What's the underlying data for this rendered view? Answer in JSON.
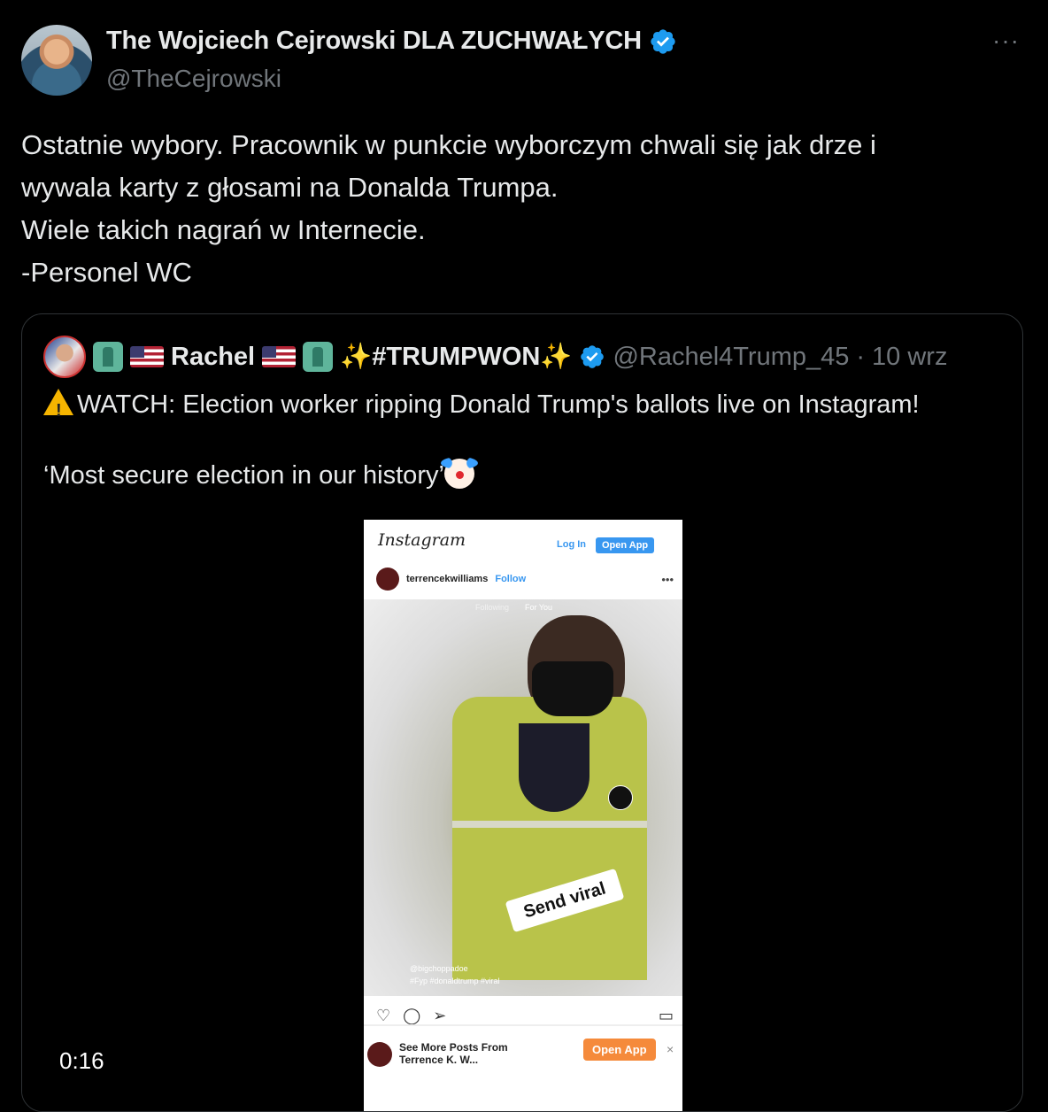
{
  "tweet": {
    "display_name": "The Wojciech Cejrowski DLA ZUCHWAŁYCH",
    "handle": "@TheCejrowski",
    "more_label": "···",
    "text": "Ostatnie wybory. Pracownik w punkcie wyborczym chwali się jak drze i\nwywala karty z głosami na Donalda Trumpa.\nWiele takich nagrań w Internecie.\n-Personel WC"
  },
  "quote": {
    "name": "Rachel",
    "tag": "✨#TRUMPWON✨",
    "handle": "@Rachel4Trump_45",
    "separator": "·",
    "date": "10 wrz",
    "text_line1": "WATCH: Election worker ripping Donald Trump's ballots live on Instagram!",
    "text_line2": "‘Most secure election in our history’"
  },
  "video": {
    "duration": "0:16",
    "instagram": {
      "logo": "Instagram",
      "login": "Log In",
      "open_app": "Open App",
      "username": "terrencekwilliams",
      "follow": "Follow",
      "tab_following": "Following",
      "tab_for_you": "For You",
      "sticker": "Send viral",
      "caption_user": "@bigchoppadoe",
      "caption_tags": "#Fyp #donaldtrump #viral",
      "banner_text_line1": "See More Posts From",
      "banner_text_line2": "Terrence K. W...",
      "banner_open": "Open App",
      "banner_close": "×"
    }
  },
  "colors": {
    "background": "#000000",
    "text": "#e7e9ea",
    "secondary": "#71767b",
    "verified": "#1d9bf0",
    "border": "#2f3336"
  }
}
